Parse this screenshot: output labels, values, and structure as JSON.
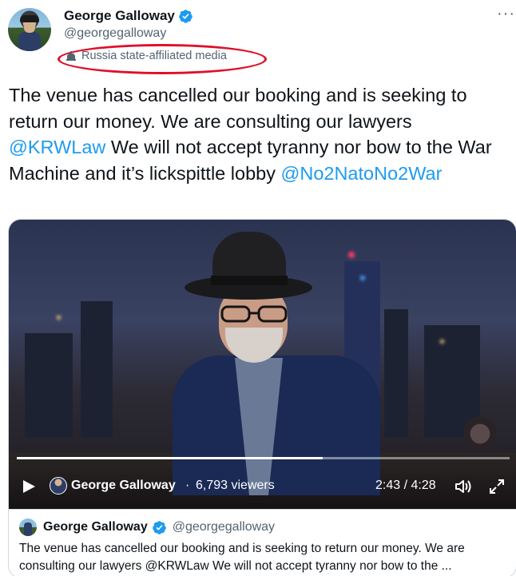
{
  "author": {
    "display_name": "George Galloway",
    "handle": "@georgegalloway"
  },
  "state_label": "Russia state-affiliated media",
  "more_menu": "···",
  "tweet": {
    "text_1": "The venue has cancelled our booking and is seeking to return our money. We are consulting our lawyers ",
    "mention_1": "@KRWLaw",
    "text_2": "  We will not accept tyranny nor bow to the War Machine and it’s lickspittle lobby ",
    "mention_2": "@No2NatoNo2War"
  },
  "video": {
    "channel_name": "George Galloway",
    "separator": "·",
    "viewers": "6,793 viewers",
    "time": "2:43 / 4:28",
    "progress": 0.62
  },
  "quote": {
    "display_name": "George Galloway",
    "handle": "@georgegalloway",
    "text": "The venue has cancelled our booking and is seeking to return our money. We are consulting our lawyers  @KRWLaw  We will not accept tyranny nor bow to the ..."
  },
  "colors": {
    "link": "#1d9bf0",
    "verified": "#1d9bf0",
    "highlight_ellipse": "#e0102a",
    "secondary_text": "#536471"
  },
  "icons": {
    "verified": "verified-badge-icon",
    "label": "government-building-icon",
    "more": "more-options-icon",
    "play": "play-icon",
    "volume": "volume-icon",
    "expand": "fullscreen-icon"
  }
}
